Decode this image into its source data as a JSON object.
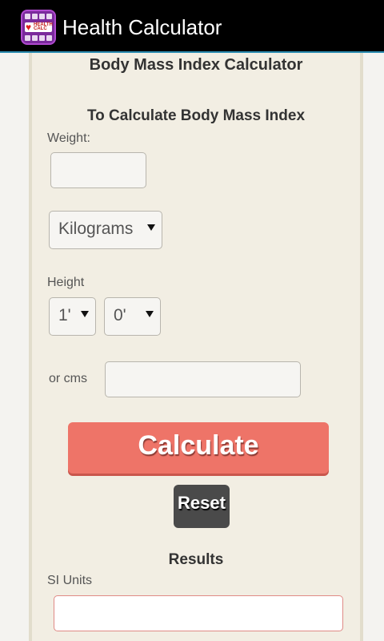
{
  "app": {
    "title": "Health Calculator",
    "icon_text": "HEALTH CALCULATOR"
  },
  "form": {
    "heading": "Body Mass Index Calculator",
    "subheading": "To Calculate Body Mass Index",
    "weight_label": "Weight:",
    "weight_value": "",
    "unit_selected": "Kilograms",
    "height_label": "Height",
    "feet_selected": "1'",
    "inches_selected": "0'",
    "cms_label": "or cms",
    "cms_value": "",
    "calculate_label": "Calculate",
    "reset_label": "Reset"
  },
  "results": {
    "heading": "Results",
    "si_label": "SI Units",
    "si_value": ""
  },
  "colors": {
    "action_bar": "#000000",
    "panel": "#f2eee3",
    "calculate_button": "#ee7468",
    "reset_button": "#4a4a4a"
  }
}
